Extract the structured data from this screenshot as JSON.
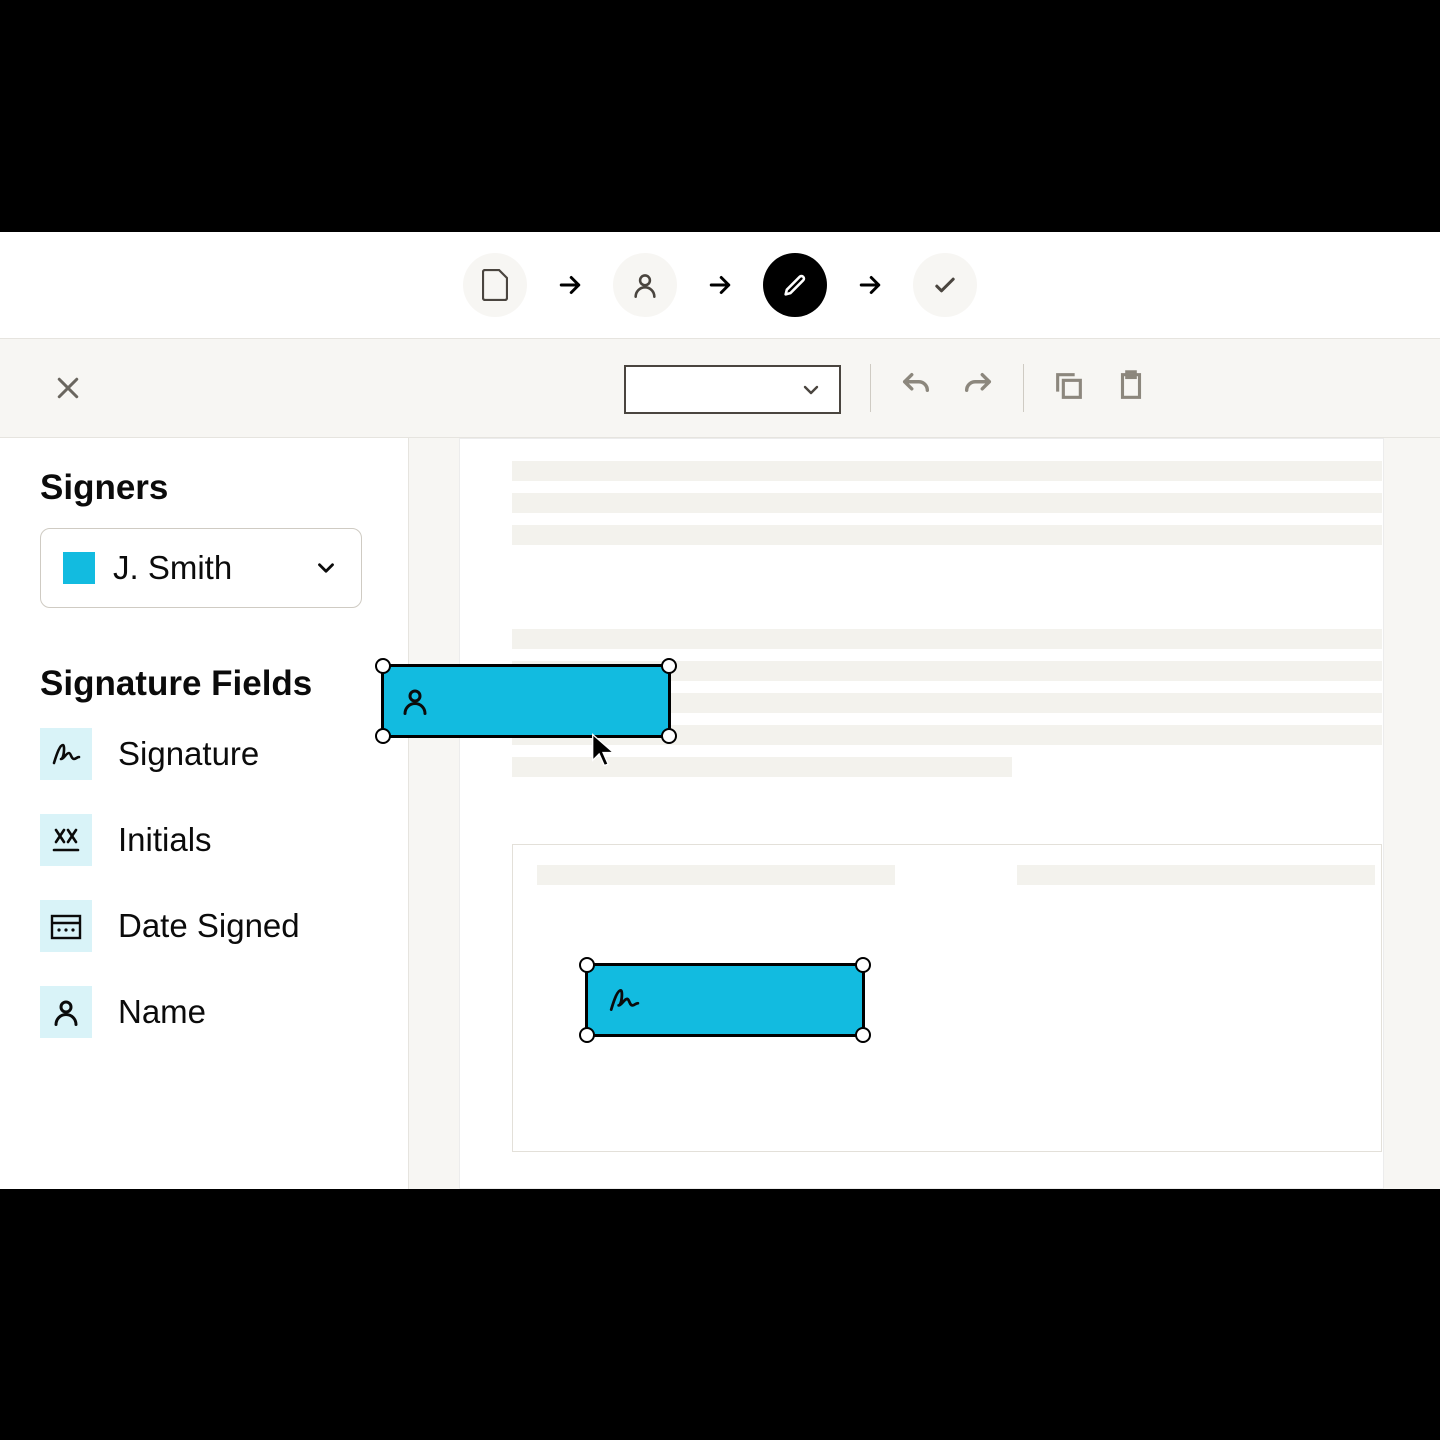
{
  "stepper": {
    "steps": [
      "document",
      "recipients",
      "edit",
      "review"
    ],
    "active_index": 2
  },
  "sidebar": {
    "signers_title": "Signers",
    "selected_signer": "J. Smith",
    "signer_color": "#12bbe0",
    "fields_title": "Signature Fields",
    "fields": [
      {
        "label": "Signature",
        "icon": "signature-icon"
      },
      {
        "label": "Initials",
        "icon": "initials-icon"
      },
      {
        "label": "Date Signed",
        "icon": "date-icon"
      },
      {
        "label": "Name",
        "icon": "person-icon"
      }
    ]
  },
  "toolbar": {
    "dropdown_value": "",
    "actions": [
      "undo",
      "redo",
      "copy",
      "paste"
    ]
  },
  "canvas": {
    "placed_fields": [
      {
        "type": "name",
        "icon": "person-icon"
      },
      {
        "type": "signature",
        "icon": "signature-icon"
      }
    ]
  }
}
